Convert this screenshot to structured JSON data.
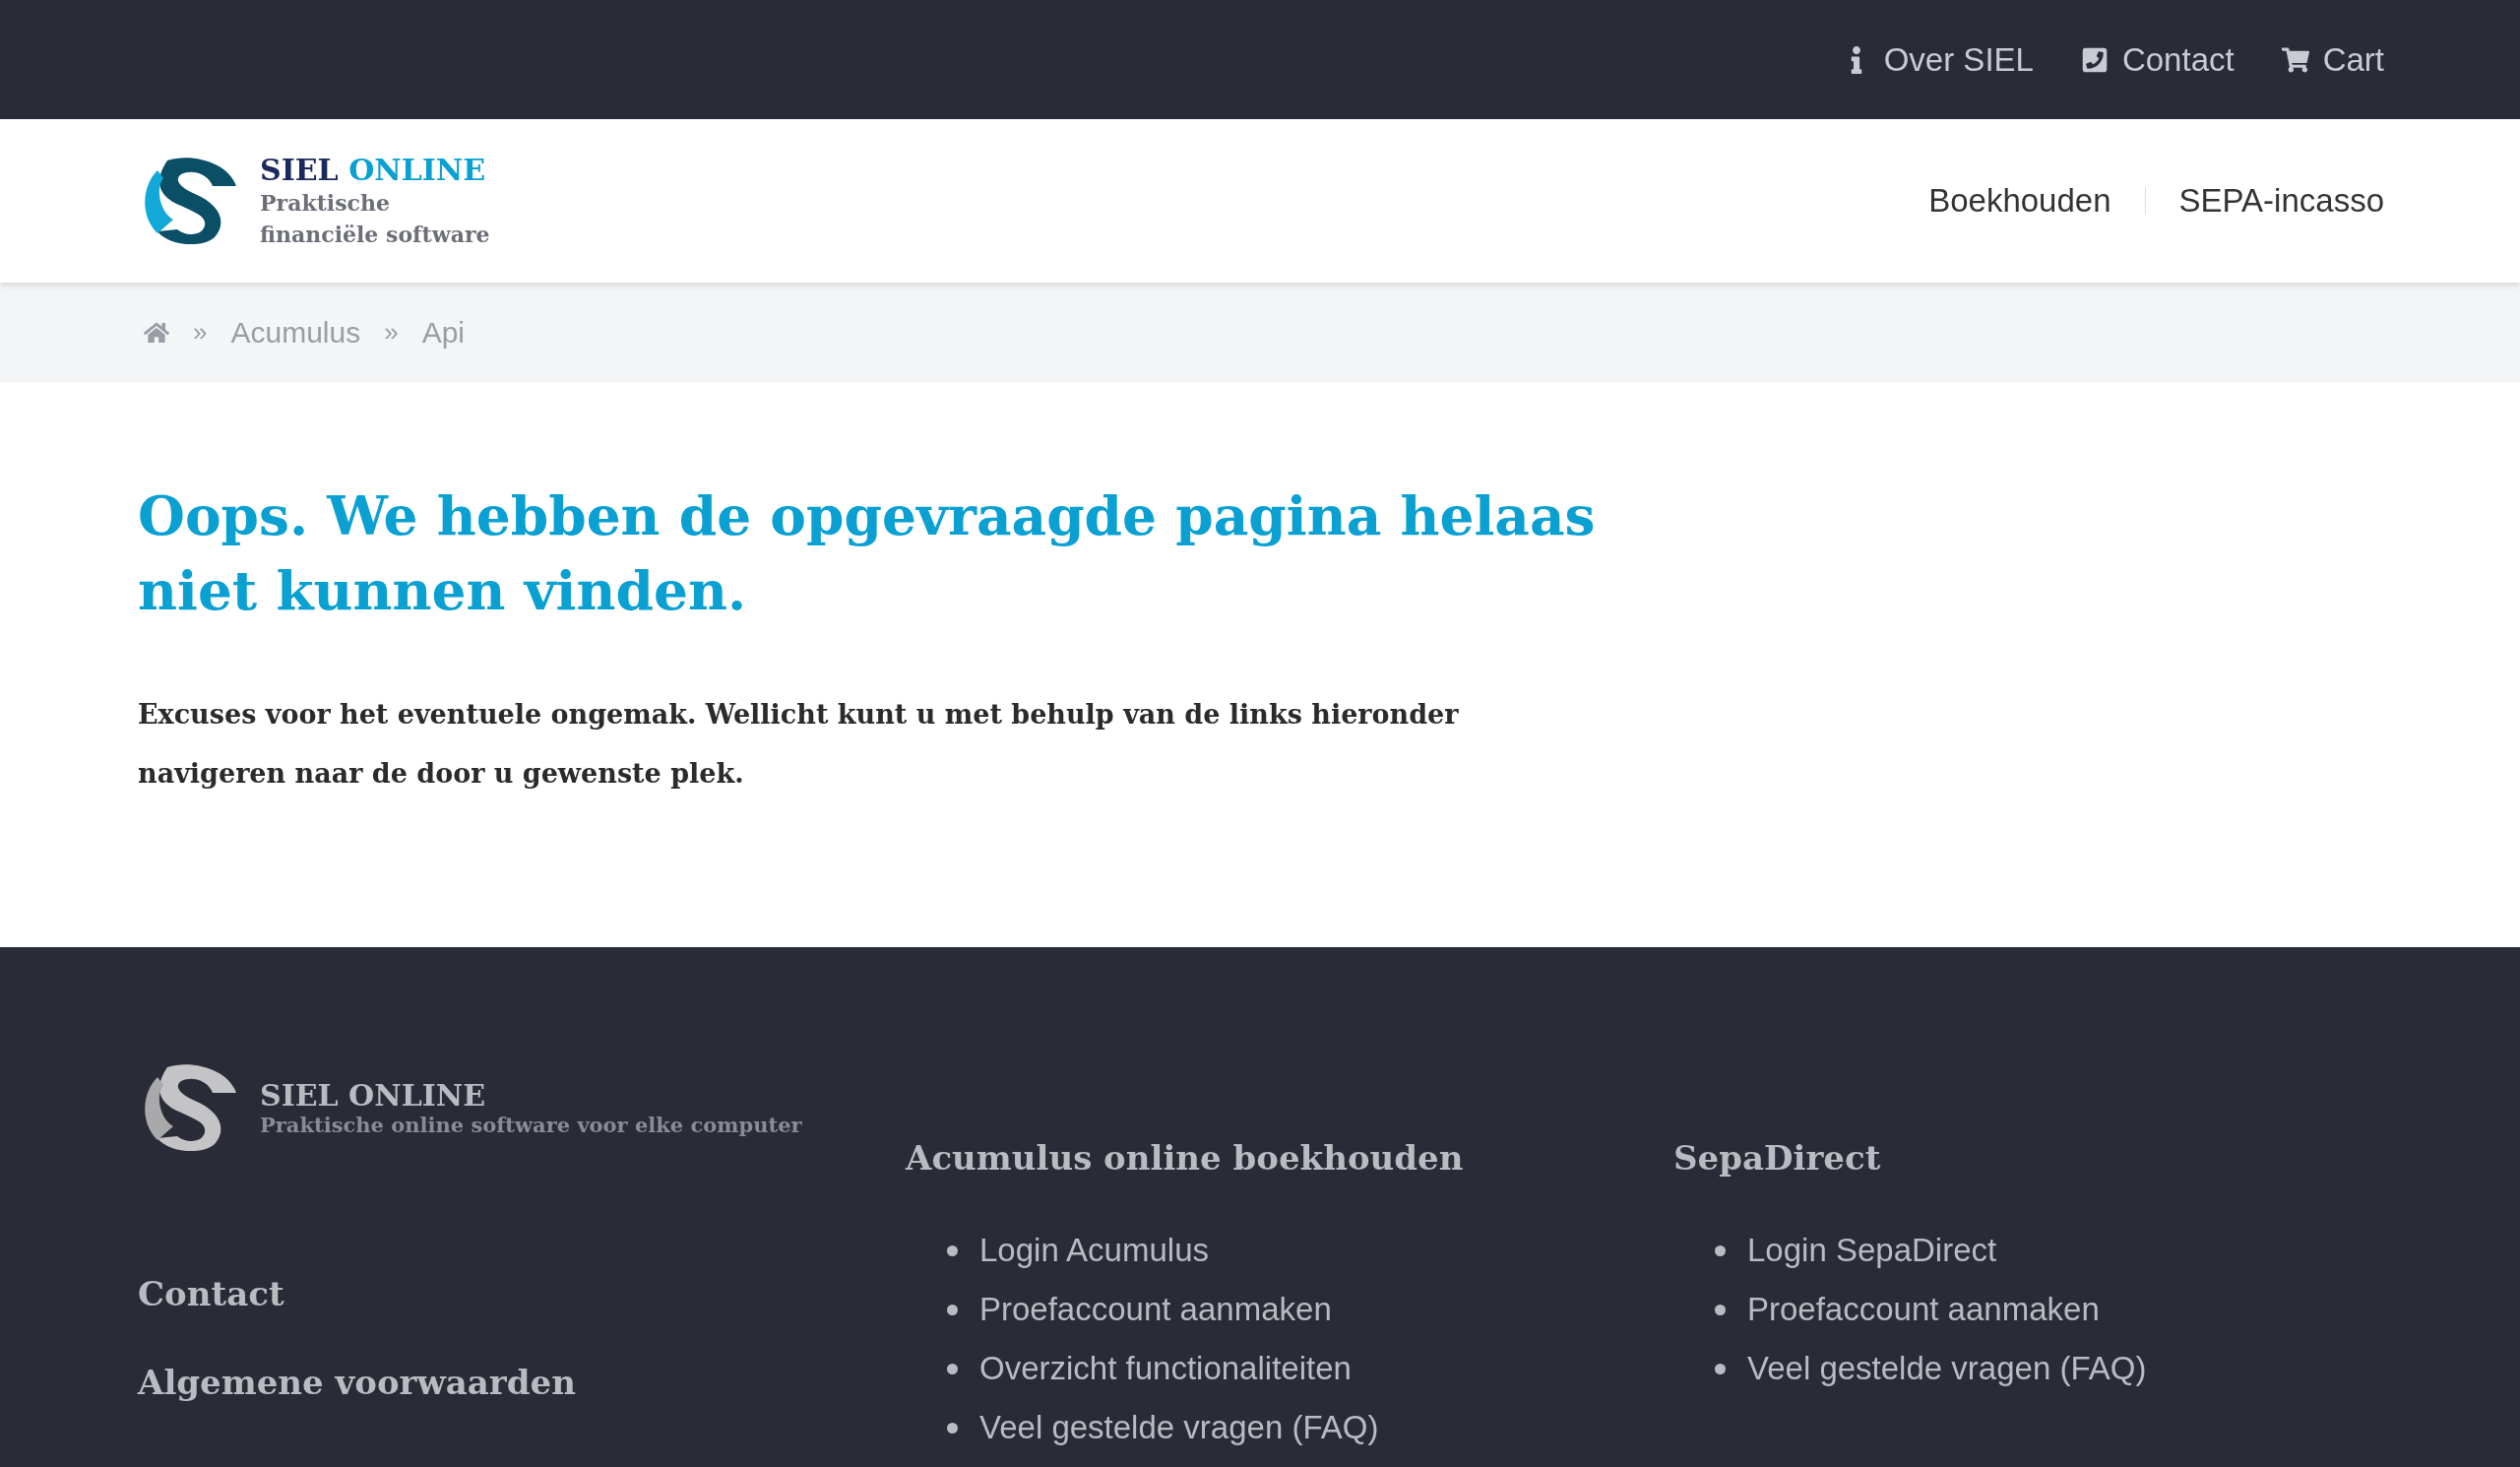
{
  "top_bar": {
    "links": [
      {
        "kind": "info",
        "label": "Over SIEL"
      },
      {
        "kind": "phone",
        "label": "Contact"
      },
      {
        "kind": "cart",
        "label": "Cart"
      }
    ]
  },
  "header": {
    "logo": {
      "name_part1": "SIEL",
      "name_part2": "ONLINE",
      "tagline_line1": "Praktische",
      "tagline_line2": "financiële software"
    },
    "nav": [
      "Boekhouden",
      "SEPA-incasso"
    ]
  },
  "breadcrumb": {
    "items": [
      {
        "separator": "»",
        "label": "Acumulus"
      },
      {
        "separator": "»",
        "label": "Api"
      }
    ]
  },
  "main": {
    "heading": "Oops. We hebben de opgevraagde pagina helaas niet kunnen vinden.",
    "text": "Excuses voor het eventuele ongemak. Wellicht kunt u met behulp van de links hieronder navigeren naar de door u gewenste plek."
  },
  "footer": {
    "logo": {
      "name": "SIEL ONLINE",
      "tagline": "Praktische online software voor elke computer"
    },
    "links": [
      "Contact",
      "Algemene voorwaarden"
    ],
    "columns": [
      {
        "title": "Acumulus online boekhouden",
        "items": [
          "Login Acumulus",
          "Proefaccount aanmaken",
          "Overzicht functionaliteiten",
          "Veel gestelde vragen (FAQ)"
        ]
      },
      {
        "title": "SepaDirect",
        "items": [
          "Login SepaDirect",
          "Proefaccount aanmaken",
          "Veel gestelde vragen (FAQ)"
        ]
      }
    ]
  }
}
